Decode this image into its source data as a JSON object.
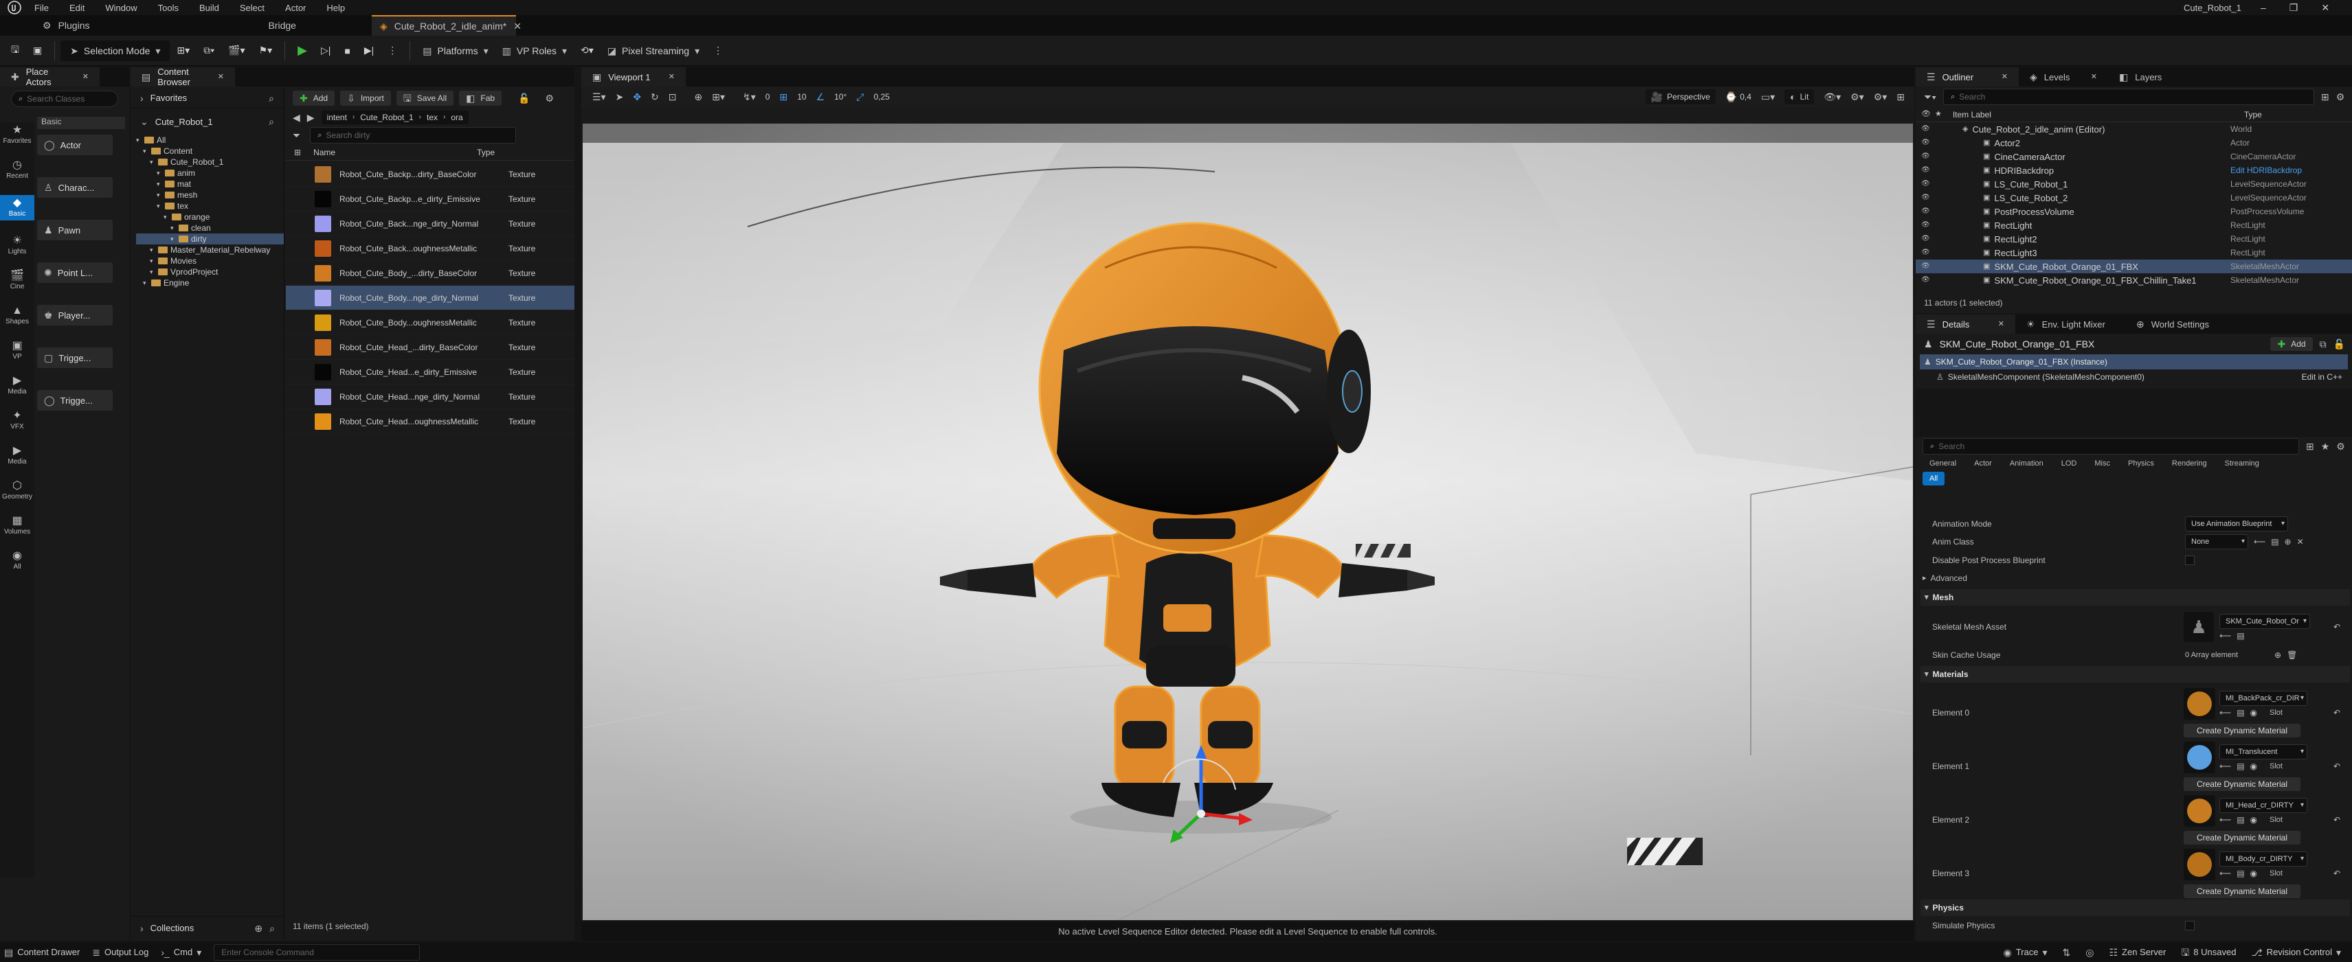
{
  "menu": [
    "File",
    "Edit",
    "Window",
    "Tools",
    "Build",
    "Select",
    "Actor",
    "Help"
  ],
  "window_title": "Cute_Robot_1",
  "tabs": {
    "plugins": "Plugins",
    "bridge": "Bridge",
    "level": "Cute_Robot_2_idle_anim*"
  },
  "toolbar": {
    "selection_mode": "Selection Mode",
    "platforms": "Platforms",
    "vp_roles": "VP Roles",
    "pixel_streaming": "Pixel Streaming"
  },
  "place_actors": {
    "tab": "Place Actors",
    "search_placeholder": "Search Classes",
    "group": "Basic",
    "items": [
      "Actor",
      "Charac...",
      "Pawn",
      "Point L...",
      "Player...",
      "Trigge...",
      "Trigge..."
    ],
    "categories": [
      "Favorites",
      "Recent",
      "Basic",
      "Lights",
      "Cine",
      "Shapes",
      "VP",
      "Media",
      "VFX",
      "Media",
      "Geometry",
      "Volumes",
      "All"
    ]
  },
  "content_browser": {
    "tab": "Content Browser",
    "favorites": "Favorites",
    "project": "Cute_Robot_1",
    "add": "Add",
    "import": "Import",
    "save_all": "Save All",
    "fab": "Fab",
    "breadcrumb": [
      "intent",
      "Cute_Robot_1",
      "tex",
      "ora"
    ],
    "search_placeholder": "Search dirty",
    "col_name": "Name",
    "col_type": "Type",
    "tree": [
      {
        "label": "All",
        "indent": 0
      },
      {
        "label": "Content",
        "indent": 1
      },
      {
        "label": "Cute_Robot_1",
        "indent": 2
      },
      {
        "label": "anim",
        "indent": 3
      },
      {
        "label": "mat",
        "indent": 3
      },
      {
        "label": "mesh",
        "indent": 3
      },
      {
        "label": "tex",
        "indent": 3
      },
      {
        "label": "orange",
        "indent": 4
      },
      {
        "label": "clean",
        "indent": 5
      },
      {
        "label": "dirty",
        "indent": 5
      },
      {
        "label": "Master_Material_Rebelway",
        "indent": 2
      },
      {
        "label": "Movies",
        "indent": 2
      },
      {
        "label": "VprodProject",
        "indent": 2
      },
      {
        "label": "Engine",
        "indent": 1
      }
    ],
    "assets": [
      {
        "name": "Robot_Cute_Backp...dirty_BaseColor",
        "type": "Texture",
        "color": "#b07030"
      },
      {
        "name": "Robot_Cute_Backp...e_dirty_Emissive",
        "type": "Texture",
        "color": "#050505"
      },
      {
        "name": "Robot_Cute_Back...nge_dirty_Normal",
        "type": "Texture",
        "color": "#9a9aef"
      },
      {
        "name": "Robot_Cute_Back...oughnessMetallic",
        "type": "Texture",
        "color": "#c05818"
      },
      {
        "name": "Robot_Cute_Body_...dirty_BaseColor",
        "type": "Texture",
        "color": "#d07a22"
      },
      {
        "name": "Robot_Cute_Body...nge_dirty_Normal",
        "type": "Texture",
        "color": "#a8a8f0"
      },
      {
        "name": "Robot_Cute_Body...oughnessMetallic",
        "type": "Texture",
        "color": "#d89a10"
      },
      {
        "name": "Robot_Cute_Head_...dirty_BaseColor",
        "type": "Texture",
        "color": "#c86d20"
      },
      {
        "name": "Robot_Cute_Head...e_dirty_Emissive",
        "type": "Texture",
        "color": "#060606"
      },
      {
        "name": "Robot_Cute_Head...nge_dirty_Normal",
        "type": "Texture",
        "color": "#a2a2ee"
      },
      {
        "name": "Robot_Cute_Head...oughnessMetallic",
        "type": "Texture",
        "color": "#e29018"
      }
    ],
    "selected_index": 5,
    "status": "11 items (1 selected)",
    "collections": "Collections"
  },
  "viewport": {
    "tab": "Viewport 1",
    "perspective": "Perspective",
    "lit": "Lit",
    "snap_move": "10",
    "snap_rot": "10°",
    "snap_scale": "0,25",
    "cam_speed": "0,4",
    "zero": "0",
    "message": "No active Level Sequence Editor detected. Please edit a Level Sequence to enable full controls."
  },
  "outliner": {
    "tabs": [
      "Outliner",
      "Levels",
      "Layers"
    ],
    "search_placeholder": "Search",
    "col_label": "Item Label",
    "col_type": "Type",
    "rows": [
      {
        "label": "Cute_Robot_2_idle_anim (Editor)",
        "type": "World",
        "indent": 0
      },
      {
        "label": "Actor2",
        "type": "Actor",
        "indent": 1
      },
      {
        "label": "CineCameraActor",
        "type": "CineCameraActor",
        "indent": 1
      },
      {
        "label": "HDRIBackdrop",
        "type": "Edit HDRIBackdrop",
        "indent": 1
      },
      {
        "label": "LS_Cute_Robot_1",
        "type": "LevelSequenceActor",
        "indent": 1
      },
      {
        "label": "LS_Cute_Robot_2",
        "type": "LevelSequenceActor",
        "indent": 1
      },
      {
        "label": "PostProcessVolume",
        "type": "PostProcessVolume",
        "indent": 1
      },
      {
        "label": "RectLight",
        "type": "RectLight",
        "indent": 1
      },
      {
        "label": "RectLight2",
        "type": "RectLight",
        "indent": 1
      },
      {
        "label": "RectLight3",
        "type": "RectLight",
        "indent": 1
      },
      {
        "label": "SKM_Cute_Robot_Orange_01_FBX",
        "type": "SkeletalMeshActor",
        "indent": 1
      },
      {
        "label": "SKM_Cute_Robot_Orange_01_FBX_Chillin_Take1",
        "type": "SkeletalMeshActor",
        "indent": 1
      }
    ],
    "selected_index": 10,
    "status": "11 actors (1 selected)"
  },
  "details": {
    "tabs": [
      "Details",
      "Env. Light Mixer",
      "World Settings"
    ],
    "actor": "SKM_Cute_Robot_Orange_01_FBX",
    "add": "Add",
    "instance": "SKM_Cute_Robot_Orange_01_FBX (Instance)",
    "component": "SkeletalMeshComponent (SkeletalMeshComponent0)",
    "edit_cpp": "Edit in C++",
    "search_placeholder": "Search",
    "filters": [
      "General",
      "Actor",
      "Animation",
      "LOD",
      "Misc",
      "Physics",
      "Rendering",
      "Streaming"
    ],
    "filter_all": "All",
    "animation_mode_label": "Animation Mode",
    "animation_mode_value": "Use Animation Blueprint",
    "anim_class_label": "Anim Class",
    "anim_class_value": "None",
    "disable_pp_label": "Disable Post Process Blueprint",
    "advanced": "Advanced",
    "mesh_section": "Mesh",
    "skeletal_mesh_label": "Skeletal Mesh Asset",
    "skeletal_mesh_value": "SKM_Cute_Robot_Or",
    "skin_cache_label": "Skin Cache Usage",
    "skin_cache_value": "0 Array element",
    "materials_section": "Materials",
    "materials": [
      {
        "label": "Element 0",
        "value": "MI_BackPack_cr_DIR",
        "thumb": "#c07a20"
      },
      {
        "label": "Element 1",
        "value": "MI_Translucent",
        "thumb": "#5aa0e0"
      },
      {
        "label": "Element 2",
        "value": "MI_Head_cr_DIRTY",
        "thumb": "#c87c22"
      },
      {
        "label": "Element 3",
        "value": "MI_Body_cr_DIRTY",
        "thumb": "#b8721c"
      }
    ],
    "slot": "Slot",
    "create_dynamic": "Create Dynamic Material",
    "physics_section": "Physics",
    "simulate_physics": "Simulate Physics"
  },
  "statusbar": {
    "content_drawer": "Content Drawer",
    "output_log": "Output Log",
    "cmd": "Cmd",
    "console_placeholder": "Enter Console Command",
    "trace": "Trace",
    "zen": "Zen Server",
    "unsaved": "8 Unsaved",
    "revision": "Revision Control"
  },
  "colors": {
    "accent": "#0e70c0",
    "selection": "#3b4e6b",
    "robot": "#e0892a",
    "folder": "#c89a4a",
    "play": "#3fbf3f"
  }
}
